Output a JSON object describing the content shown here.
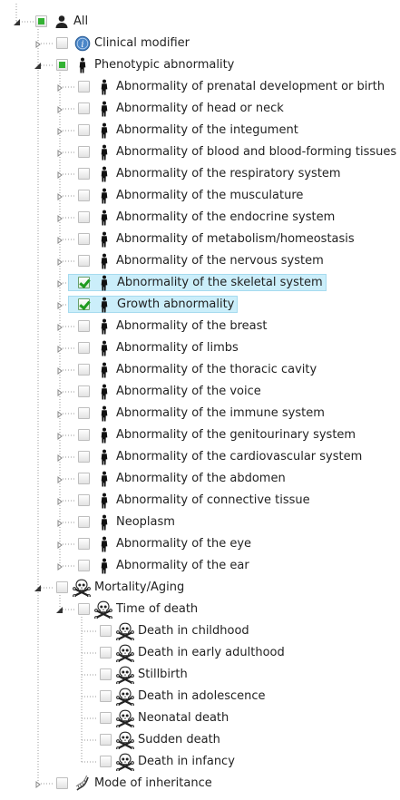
{
  "tree": {
    "rows": [
      {
        "label": "All",
        "depth": 0,
        "icon": "person-icon",
        "check": "partial",
        "toggle": "expanded",
        "selected": false
      },
      {
        "label": "Clinical modifier",
        "depth": 1,
        "icon": "info-globe-icon",
        "check": "none",
        "toggle": "collapsed",
        "selected": false
      },
      {
        "label": "Phenotypic abnormality",
        "depth": 1,
        "icon": "human-figure-icon",
        "check": "partial",
        "toggle": "expanded",
        "selected": false
      },
      {
        "label": "Abnormality of prenatal development or birth",
        "depth": 2,
        "icon": "human-figure-icon",
        "check": "none",
        "toggle": "collapsed",
        "selected": false
      },
      {
        "label": "Abnormality of head or neck",
        "depth": 2,
        "icon": "human-figure-icon",
        "check": "none",
        "toggle": "collapsed",
        "selected": false
      },
      {
        "label": "Abnormality of the integument",
        "depth": 2,
        "icon": "human-figure-icon",
        "check": "none",
        "toggle": "collapsed",
        "selected": false
      },
      {
        "label": "Abnormality of blood and blood-forming tissues",
        "depth": 2,
        "icon": "human-figure-icon",
        "check": "none",
        "toggle": "collapsed",
        "selected": false
      },
      {
        "label": "Abnormality of the respiratory system",
        "depth": 2,
        "icon": "human-figure-icon",
        "check": "none",
        "toggle": "collapsed",
        "selected": false
      },
      {
        "label": "Abnormality of the musculature",
        "depth": 2,
        "icon": "human-figure-icon",
        "check": "none",
        "toggle": "collapsed",
        "selected": false
      },
      {
        "label": "Abnormality of the endocrine system",
        "depth": 2,
        "icon": "human-figure-icon",
        "check": "none",
        "toggle": "collapsed",
        "selected": false
      },
      {
        "label": "Abnormality of metabolism/homeostasis",
        "depth": 2,
        "icon": "human-figure-icon",
        "check": "none",
        "toggle": "collapsed",
        "selected": false
      },
      {
        "label": "Abnormality of the nervous system",
        "depth": 2,
        "icon": "human-figure-icon",
        "check": "none",
        "toggle": "collapsed",
        "selected": false
      },
      {
        "label": "Abnormality of the skeletal system",
        "depth": 2,
        "icon": "human-figure-icon",
        "check": "checked",
        "toggle": "collapsed",
        "selected": true
      },
      {
        "label": "Growth abnormality",
        "depth": 2,
        "icon": "human-figure-icon",
        "check": "checked",
        "toggle": "collapsed",
        "selected": true
      },
      {
        "label": "Abnormality of the breast",
        "depth": 2,
        "icon": "human-figure-icon",
        "check": "none",
        "toggle": "collapsed",
        "selected": false
      },
      {
        "label": "Abnormality of limbs",
        "depth": 2,
        "icon": "human-figure-icon",
        "check": "none",
        "toggle": "collapsed",
        "selected": false
      },
      {
        "label": "Abnormality of the thoracic cavity",
        "depth": 2,
        "icon": "human-figure-icon",
        "check": "none",
        "toggle": "collapsed",
        "selected": false
      },
      {
        "label": "Abnormality of the voice",
        "depth": 2,
        "icon": "human-figure-icon",
        "check": "none",
        "toggle": "collapsed",
        "selected": false
      },
      {
        "label": "Abnormality of the immune system",
        "depth": 2,
        "icon": "human-figure-icon",
        "check": "none",
        "toggle": "collapsed",
        "selected": false
      },
      {
        "label": "Abnormality of the genitourinary system",
        "depth": 2,
        "icon": "human-figure-icon",
        "check": "none",
        "toggle": "collapsed",
        "selected": false
      },
      {
        "label": "Abnormality of the cardiovascular system",
        "depth": 2,
        "icon": "human-figure-icon",
        "check": "none",
        "toggle": "collapsed",
        "selected": false
      },
      {
        "label": "Abnormality of the abdomen",
        "depth": 2,
        "icon": "human-figure-icon",
        "check": "none",
        "toggle": "collapsed",
        "selected": false
      },
      {
        "label": "Abnormality of connective tissue",
        "depth": 2,
        "icon": "human-figure-icon",
        "check": "none",
        "toggle": "collapsed",
        "selected": false
      },
      {
        "label": "Neoplasm",
        "depth": 2,
        "icon": "human-figure-icon",
        "check": "none",
        "toggle": "collapsed",
        "selected": false
      },
      {
        "label": "Abnormality of the eye",
        "depth": 2,
        "icon": "human-figure-icon",
        "check": "none",
        "toggle": "collapsed",
        "selected": false
      },
      {
        "label": "Abnormality of the ear",
        "depth": 2,
        "icon": "human-figure-icon",
        "check": "none",
        "toggle": "collapsed",
        "selected": false
      },
      {
        "label": "Mortality/Aging",
        "depth": 1,
        "icon": "skull-crossbones-icon",
        "check": "none",
        "toggle": "expanded",
        "selected": false
      },
      {
        "label": "Time of death",
        "depth": 2,
        "icon": "skull-crossbones-icon",
        "check": "none",
        "toggle": "expanded",
        "selected": false
      },
      {
        "label": "Death in childhood",
        "depth": 3,
        "icon": "skull-crossbones-icon",
        "check": "none",
        "toggle": "none",
        "selected": false
      },
      {
        "label": "Death in early adulthood",
        "depth": 3,
        "icon": "skull-crossbones-icon",
        "check": "none",
        "toggle": "none",
        "selected": false
      },
      {
        "label": "Stillbirth",
        "depth": 3,
        "icon": "skull-crossbones-icon",
        "check": "none",
        "toggle": "none",
        "selected": false
      },
      {
        "label": "Death in adolescence",
        "depth": 3,
        "icon": "skull-crossbones-icon",
        "check": "none",
        "toggle": "none",
        "selected": false
      },
      {
        "label": "Neonatal death",
        "depth": 3,
        "icon": "skull-crossbones-icon",
        "check": "none",
        "toggle": "none",
        "selected": false
      },
      {
        "label": "Sudden death",
        "depth": 3,
        "icon": "skull-crossbones-icon",
        "check": "none",
        "toggle": "none",
        "selected": false
      },
      {
        "label": "Death in infancy",
        "depth": 3,
        "icon": "skull-crossbones-icon",
        "check": "none",
        "toggle": "none",
        "selected": false
      },
      {
        "label": "Mode of inheritance",
        "depth": 1,
        "icon": "dna-helix-icon",
        "check": "none",
        "toggle": "collapsed",
        "selected": false
      }
    ]
  },
  "colors": {
    "selection_bg": "#cbeefa",
    "selection_border": "#a6dbef",
    "check_green": "#1e9c1e",
    "partial_green": "#33b233",
    "connector": "#9a9a9a"
  }
}
